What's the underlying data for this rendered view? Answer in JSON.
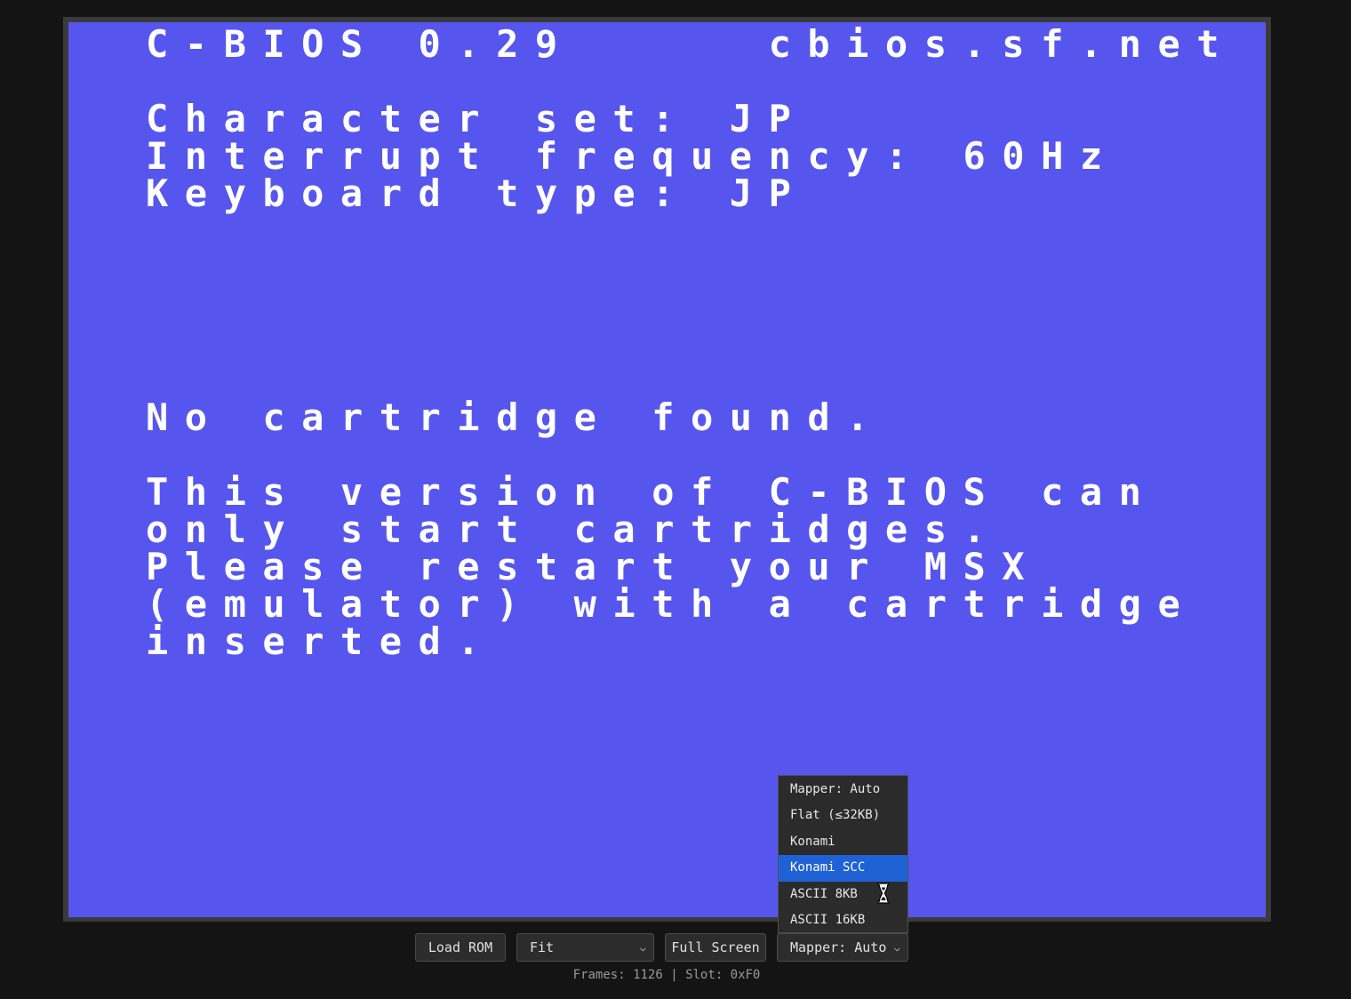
{
  "screen": {
    "background": "#5656ee",
    "text_color": "#ffffff",
    "lines": [
      "C-BIOS 0.29     cbios.sf.net",
      "",
      "Character set: JP",
      "Interrupt frequency: 60Hz",
      "Keyboard type: JP",
      "",
      "",
      "",
      "",
      "",
      "No cartridge found.",
      "",
      "This version of C-BIOS can",
      "only start cartridges.",
      "Please restart your MSX",
      "(emulator) with a cartridge",
      "inserted."
    ]
  },
  "toolbar": {
    "load_rom_label": "Load ROM",
    "scale_select_value": "Fit",
    "fullscreen_label": "Full Screen",
    "mapper_select_value": "Mapper: Auto"
  },
  "mapper_dropdown": {
    "options": [
      "Mapper: Auto",
      "Flat (≤32KB)",
      "Konami",
      "Konami SCC",
      "ASCII 8KB",
      "ASCII 16KB"
    ],
    "highlighted": "Konami SCC"
  },
  "status": {
    "text": "Frames: 1126 | Slot: 0xF0"
  },
  "icons": {
    "select_arrow": "chevron-down-icon",
    "cursor": "hourglass-cursor-icon"
  }
}
